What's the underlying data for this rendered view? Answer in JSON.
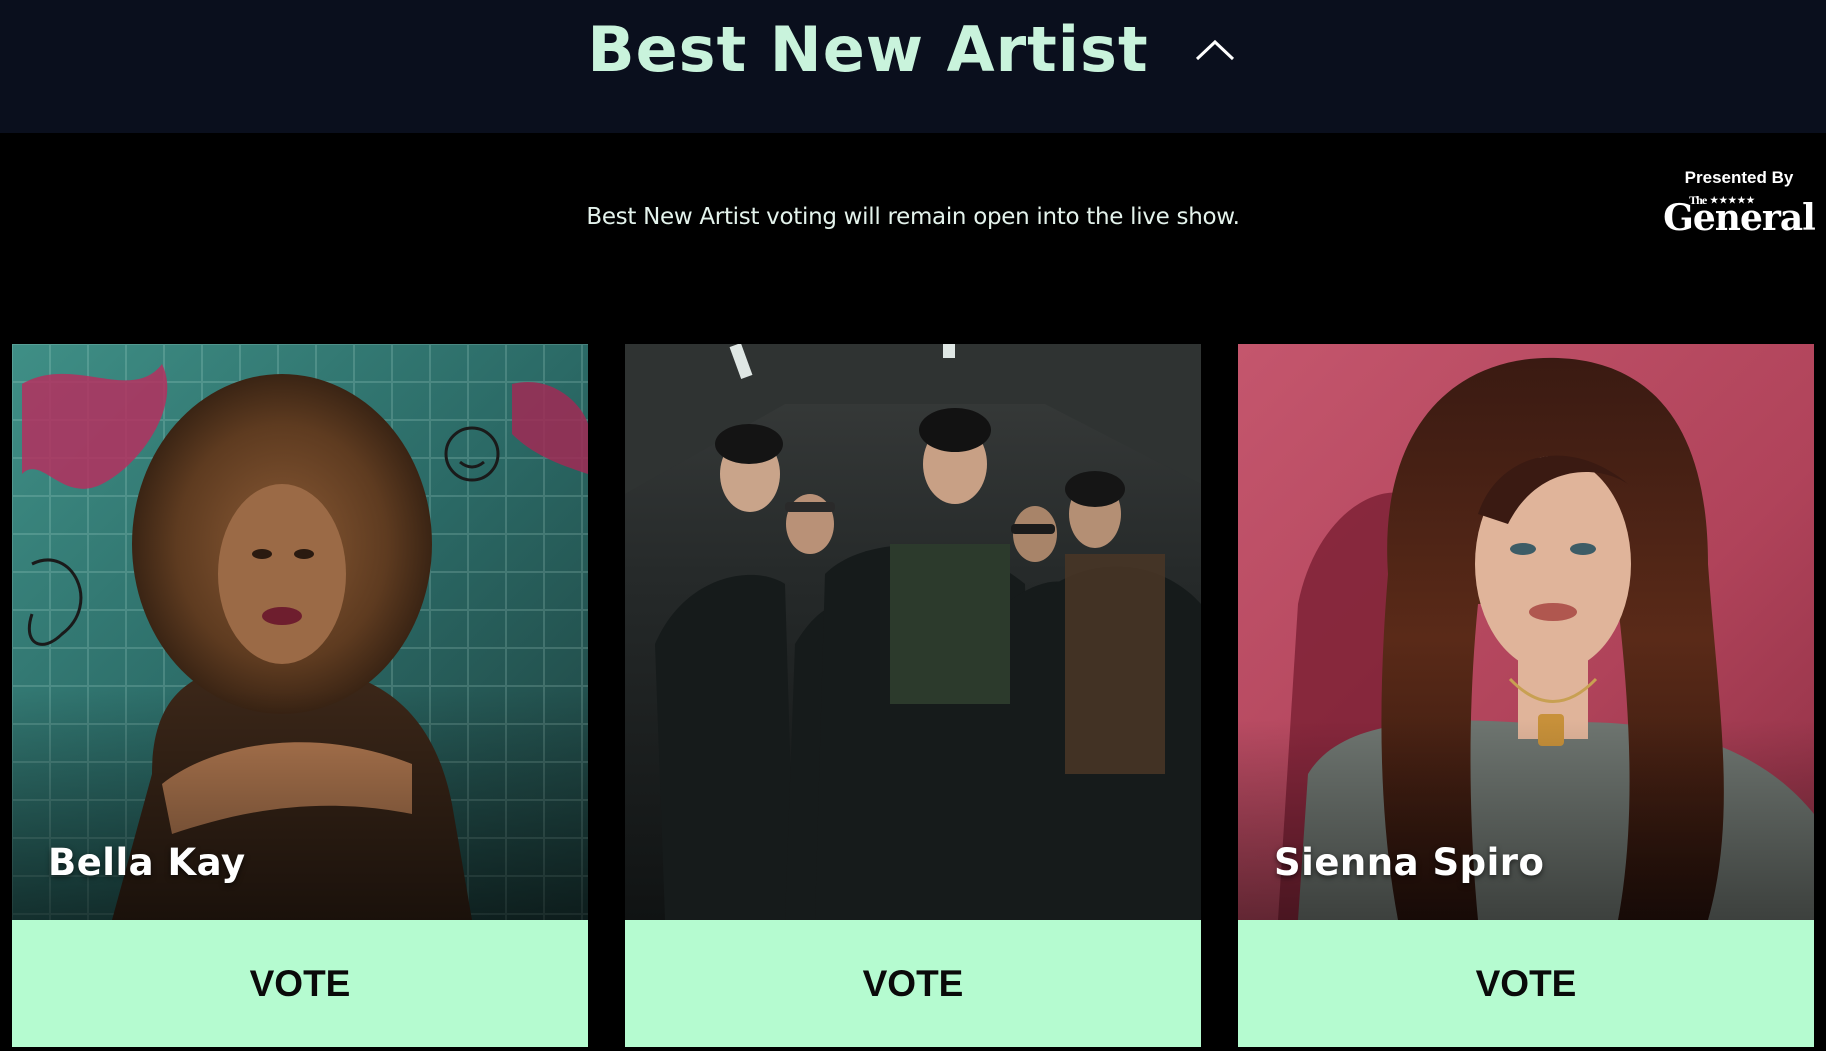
{
  "header": {
    "title": "Best New Artist",
    "toggle_icon": "chevron-up-icon"
  },
  "notice": "Best New Artist voting will remain open into the live show.",
  "sponsor": {
    "label": "Presented By",
    "logo_small": "The",
    "logo_stars": "★★★★★",
    "logo_main": "General"
  },
  "colors": {
    "header_bg": "#0a0f1d",
    "page_bg": "#000000",
    "title": "#c9f3dc",
    "vote_bg": "#b5fbd0"
  },
  "nominees": [
    {
      "name": "Bella Kay",
      "vote_label": "VOTE",
      "photo": "nominee-photo-tiled-graffiti"
    },
    {
      "name": "",
      "vote_label": "VOTE",
      "photo": "nominee-photo-group-dark"
    },
    {
      "name": "Sienna Spiro",
      "vote_label": "VOTE",
      "photo": "nominee-photo-red-wall"
    }
  ]
}
